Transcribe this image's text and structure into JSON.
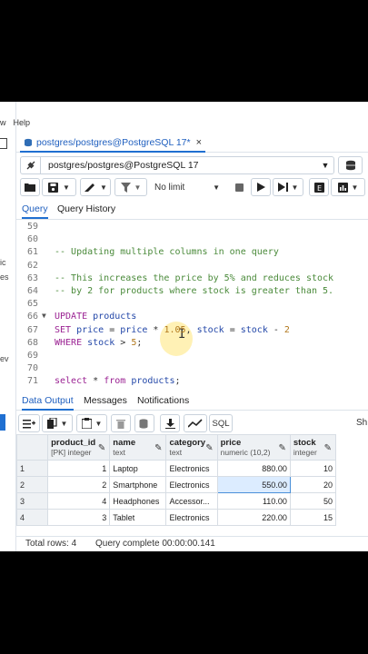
{
  "menu": {
    "visible": "w",
    "help": "Help"
  },
  "left_fragments": [
    "ic",
    "es",
    "ev"
  ],
  "tab": {
    "title": "postgres/postgres@PostgreSQL 17*",
    "close": "×"
  },
  "connection": {
    "text": "postgres/postgres@PostgreSQL 17"
  },
  "toolbar": {
    "limit": "No limit"
  },
  "query_tabs": [
    "Query",
    "Query History"
  ],
  "editor": {
    "lines": [
      {
        "n": "59",
        "segs": []
      },
      {
        "n": "60",
        "segs": []
      },
      {
        "n": "61",
        "segs": [
          {
            "c": "cm",
            "t": "-- Updating multiple columns in one query"
          }
        ]
      },
      {
        "n": "62",
        "segs": []
      },
      {
        "n": "63",
        "segs": [
          {
            "c": "cm",
            "t": "-- This increases the price by 5% and reduces stock"
          }
        ]
      },
      {
        "n": "64",
        "segs": [
          {
            "c": "cm",
            "t": "-- by 2 for products where stock is greater than 5."
          }
        ]
      },
      {
        "n": "65",
        "segs": []
      },
      {
        "n": "66",
        "fold": true,
        "segs": [
          {
            "c": "kw",
            "t": "UPDATE"
          },
          {
            "c": "op",
            "t": " "
          },
          {
            "c": "ident",
            "t": "products"
          }
        ]
      },
      {
        "n": "67",
        "segs": [
          {
            "c": "kw",
            "t": "SET"
          },
          {
            "c": "op",
            "t": " "
          },
          {
            "c": "ident",
            "t": "price"
          },
          {
            "c": "op",
            "t": " = "
          },
          {
            "c": "ident",
            "t": "price"
          },
          {
            "c": "op",
            "t": " * "
          },
          {
            "c": "num",
            "t": "1.05"
          },
          {
            "c": "op",
            "t": ", "
          },
          {
            "c": "ident",
            "t": "stock"
          },
          {
            "c": "op",
            "t": " = "
          },
          {
            "c": "ident",
            "t": "stock"
          },
          {
            "c": "op",
            "t": " - "
          },
          {
            "c": "num",
            "t": "2"
          }
        ]
      },
      {
        "n": "68",
        "segs": [
          {
            "c": "kw",
            "t": "WHERE"
          },
          {
            "c": "op",
            "t": " "
          },
          {
            "c": "ident",
            "t": "stock"
          },
          {
            "c": "op",
            "t": " > "
          },
          {
            "c": "num",
            "t": "5"
          },
          {
            "c": "op",
            "t": ";"
          }
        ]
      },
      {
        "n": "69",
        "segs": []
      },
      {
        "n": "70",
        "segs": []
      },
      {
        "n": "71",
        "segs": [
          {
            "c": "kw",
            "t": "select"
          },
          {
            "c": "op",
            "t": " * "
          },
          {
            "c": "kw",
            "t": "from"
          },
          {
            "c": "op",
            "t": " "
          },
          {
            "c": "ident",
            "t": "products"
          },
          {
            "c": "op",
            "t": ";"
          }
        ]
      }
    ]
  },
  "result_tabs": [
    "Data Output",
    "Messages",
    "Notifications"
  ],
  "results_toolbar": {
    "sql": "SQL",
    "sh": "Sh"
  },
  "grid": {
    "columns": [
      {
        "name": "product_id",
        "type": "[PK] integer"
      },
      {
        "name": "name",
        "type": "text"
      },
      {
        "name": "category",
        "type": "text"
      },
      {
        "name": "price",
        "type": "numeric (10,2)"
      },
      {
        "name": "stock",
        "type": "integer"
      }
    ],
    "rows": [
      {
        "rn": "1",
        "cells": [
          "1",
          "Laptop",
          "Electronics",
          "880.00",
          "10"
        ]
      },
      {
        "rn": "2",
        "cells": [
          "2",
          "Smartphone",
          "Electronics",
          "550.00",
          "20"
        ]
      },
      {
        "rn": "3",
        "cells": [
          "4",
          "Headphones",
          "Accessor...",
          "110.00",
          "50"
        ]
      },
      {
        "rn": "4",
        "cells": [
          "3",
          "Tablet",
          "Electronics",
          "220.00",
          "15"
        ]
      }
    ]
  },
  "status": {
    "rows": "Total rows: 4",
    "complete": "Query complete 00:00:00.141"
  },
  "colors": {
    "accent": "#1f6fd1",
    "selected_cell": "#dcecff"
  }
}
